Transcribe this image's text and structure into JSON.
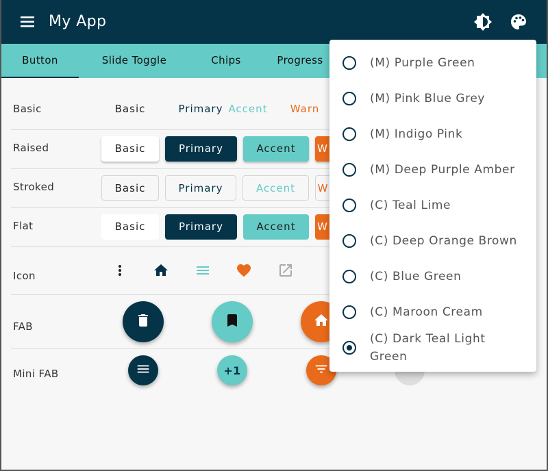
{
  "app": {
    "title": "My App"
  },
  "colors": {
    "primary": "#053449",
    "accent": "#64cbc6",
    "warn": "#ea6a1b",
    "background": "#f7f7f7"
  },
  "toolbar": {
    "icons": [
      "menu-icon",
      "brightness-icon",
      "palette-icon"
    ]
  },
  "tabs": [
    {
      "label": "Button",
      "active": true
    },
    {
      "label": "Slide Toggle",
      "active": false
    },
    {
      "label": "Chips",
      "active": false
    },
    {
      "label": "Progress",
      "active": false
    }
  ],
  "rows": {
    "basic": {
      "label": "Basic",
      "buttons": [
        "Basic",
        "Primary",
        "Accent",
        "Warn"
      ]
    },
    "raised": {
      "label": "Raised",
      "buttons": [
        "Basic",
        "Primary",
        "Accent",
        "W"
      ]
    },
    "stroked": {
      "label": "Stroked",
      "buttons": [
        "Basic",
        "Primary",
        "Accent",
        "W"
      ]
    },
    "flat": {
      "label": "Flat",
      "buttons": [
        "Basic",
        "Primary",
        "Accent",
        "W"
      ]
    },
    "icon": {
      "label": "Icon",
      "icons": [
        "more-vert-icon",
        "home-icon",
        "menu-icon",
        "heart-icon",
        "open-in-new-icon"
      ]
    },
    "fab": {
      "label": "FAB",
      "icons": [
        "delete-icon",
        "bookmark-icon",
        "home-icon"
      ]
    },
    "mini_fab": {
      "label": "Mini FAB",
      "icons": [
        "menu-icon",
        "plus-one-icon",
        "filter-list-icon",
        "disabled-icon"
      ],
      "plus_one_text": "+1"
    }
  },
  "theme_menu": {
    "items": [
      {
        "label": "(M) Purple Green",
        "selected": false
      },
      {
        "label": "(M) Pink Blue Grey",
        "selected": false
      },
      {
        "label": "(M) Indigo Pink",
        "selected": false
      },
      {
        "label": "(M) Deep Purple Amber",
        "selected": false
      },
      {
        "label": "(C) Teal Lime",
        "selected": false
      },
      {
        "label": "(C) Deep Orange Brown",
        "selected": false
      },
      {
        "label": "(C) Blue Green",
        "selected": false
      },
      {
        "label": "(C) Maroon Cream",
        "selected": false
      },
      {
        "label_line1": "(C) Dark Teal Light",
        "label_line2": "Green",
        "selected": true
      }
    ]
  }
}
